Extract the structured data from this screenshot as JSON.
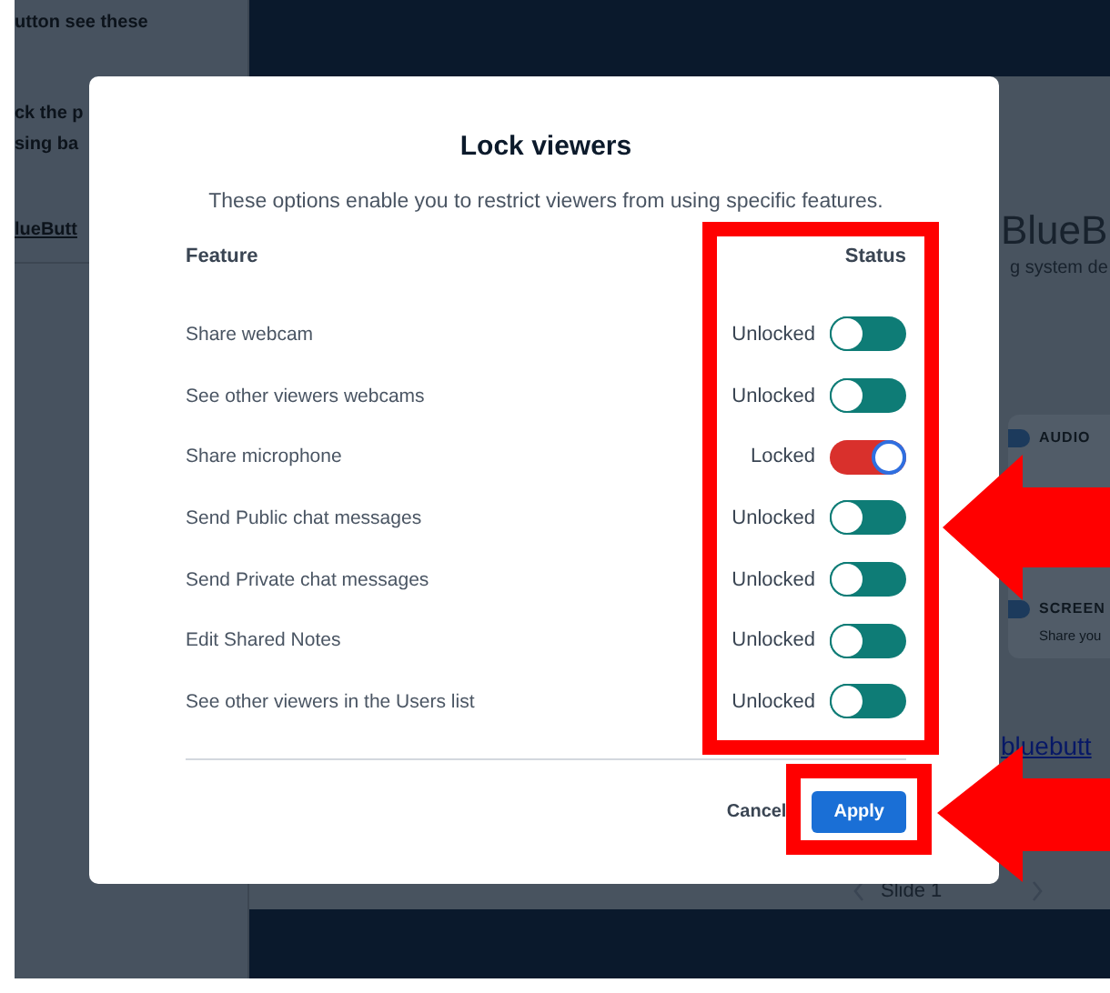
{
  "sidebar": {
    "texts": [
      "utton see these",
      "ck the p",
      "sing ba"
    ],
    "link": "lueButt"
  },
  "main": {
    "heading": "BlueB",
    "subheading": "g system de",
    "cards": [
      {
        "title": "AUDIO"
      },
      {
        "title": "SCREEN",
        "text": "Share you"
      }
    ],
    "link": "bluebutt",
    "slide_selector": "Slide 1"
  },
  "dialog": {
    "title": "Lock viewers",
    "description": "These options enable you to restrict viewers from using specific features.",
    "columns": [
      "Feature",
      "Status"
    ],
    "rows": [
      {
        "feature": "Share webcam",
        "status": "Unlocked",
        "locked": false
      },
      {
        "feature": "See other viewers webcams",
        "status": "Unlocked",
        "locked": false
      },
      {
        "feature": "Share microphone",
        "status": "Locked",
        "locked": true
      },
      {
        "feature": "Send Public chat messages",
        "status": "Unlocked",
        "locked": false
      },
      {
        "feature": "Send Private chat messages",
        "status": "Unlocked",
        "locked": false
      },
      {
        "feature": "Edit Shared Notes",
        "status": "Unlocked",
        "locked": false
      },
      {
        "feature": "See other viewers in the Users list",
        "status": "Unlocked",
        "locked": false
      }
    ],
    "buttons": [
      {
        "label": "Cancel",
        "kind": "secondary"
      },
      {
        "label": "Apply",
        "kind": "primary"
      }
    ]
  }
}
